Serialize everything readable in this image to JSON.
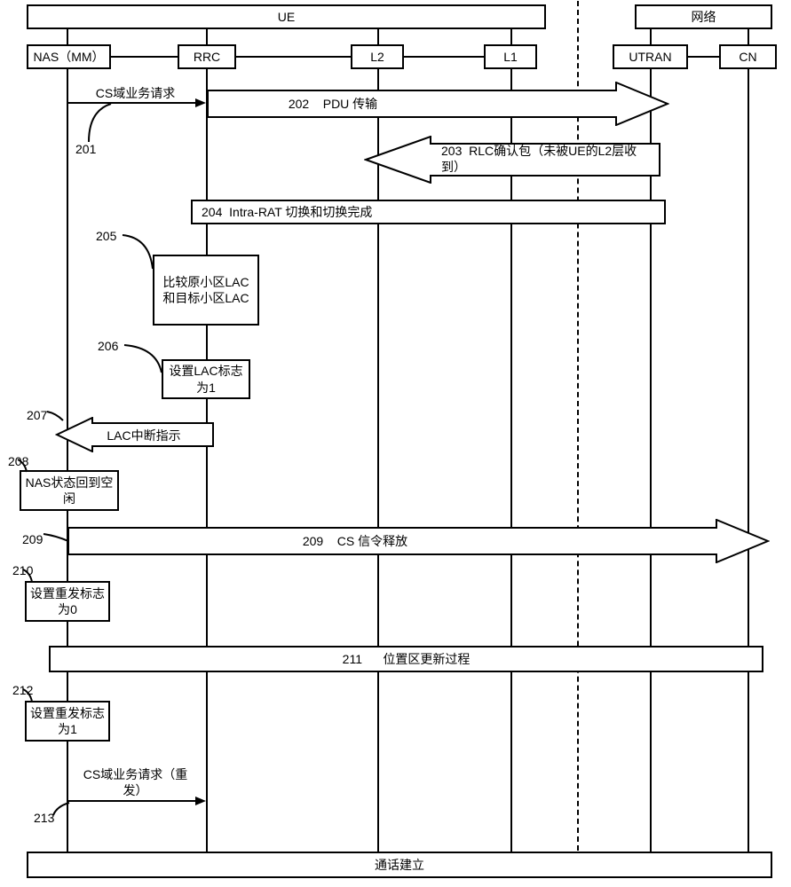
{
  "participants": {
    "ue_group": "UE",
    "network_group": "网络",
    "nas": "NAS（MM）",
    "rrc": "RRC",
    "l2": "L2",
    "l1": "L1",
    "utran": "UTRAN",
    "cn": "CN"
  },
  "steps": {
    "s201": {
      "num": "201",
      "text": "CS域业务请求"
    },
    "s202": {
      "num": "202",
      "text": "PDU 传输"
    },
    "s203": {
      "num": "203",
      "text": "RLC确认包（未被UE的L2层收到）"
    },
    "s204": {
      "num": "204",
      "text": "Intra-RAT 切换和切换完成"
    },
    "s205": {
      "num": "205",
      "text": "比较原小区LAC和目标小区LAC"
    },
    "s206": {
      "num": "206",
      "text": "设置LAC标志为1"
    },
    "s207": {
      "num": "207",
      "text": "LAC中断指示"
    },
    "s208": {
      "num": "208",
      "text": "NAS状态回到空闲"
    },
    "s209": {
      "num": "209",
      "text": "CS 信令释放"
    },
    "s210": {
      "num": "210",
      "text": "设置重发标志为0"
    },
    "s211": {
      "num": "211",
      "text": "位置区更新过程"
    },
    "s212": {
      "num": "212",
      "text": "设置重发标志为1"
    },
    "s213": {
      "num": "213",
      "text": "CS域业务请求（重发）"
    },
    "footer": "通话建立"
  }
}
